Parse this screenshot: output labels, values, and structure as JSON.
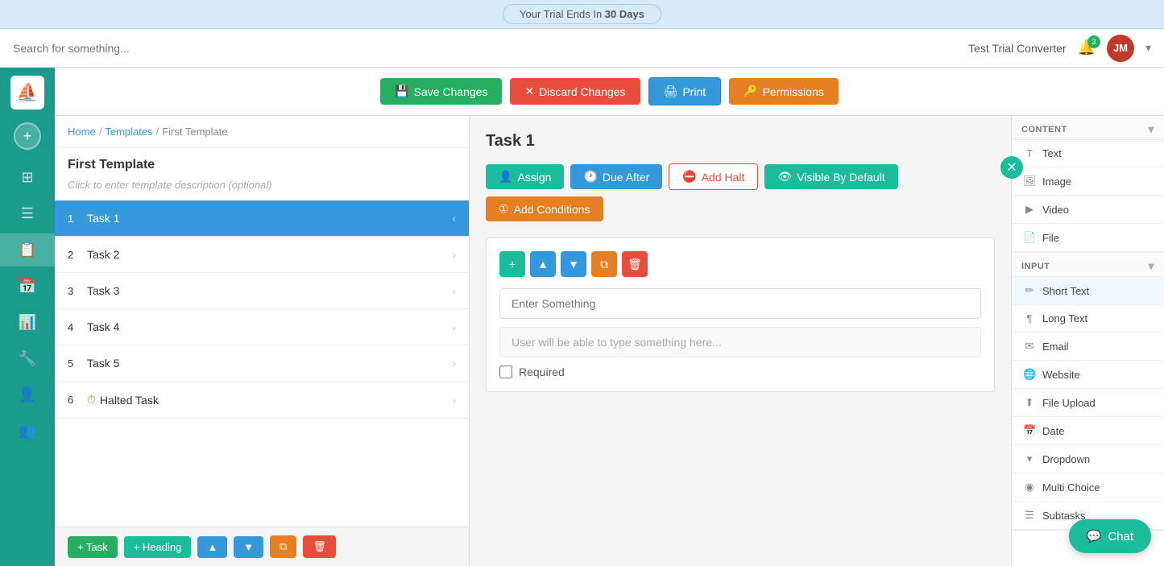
{
  "trial_bar": {
    "text": "Your Trial Ends In ",
    "bold": "30 Days"
  },
  "topbar": {
    "search_placeholder": "Search for something...",
    "workspace": "Test Trial Converter",
    "badge": "3",
    "avatar": "JM"
  },
  "toolbar": {
    "save_label": "Save Changes",
    "discard_label": "Discard Changes",
    "print_label": "Print",
    "permissions_label": "Permissions"
  },
  "sidebar": {
    "nav_items": [
      {
        "icon": "⊞",
        "name": "dashboard"
      },
      {
        "icon": "☰",
        "name": "tasks"
      },
      {
        "icon": "📅",
        "name": "calendar"
      },
      {
        "icon": "📋",
        "name": "templates"
      },
      {
        "icon": "📊",
        "name": "reports"
      },
      {
        "icon": "🔧",
        "name": "settings"
      },
      {
        "icon": "👤",
        "name": "profile"
      },
      {
        "icon": "👥",
        "name": "team"
      }
    ]
  },
  "breadcrumb": {
    "home": "Home",
    "templates": "Templates",
    "current": "First Template"
  },
  "left_panel": {
    "template_name": "First Template",
    "template_desc": "Click to enter template description (optional)",
    "tasks": [
      {
        "num": 1,
        "name": "Task 1",
        "active": true,
        "halted": false
      },
      {
        "num": 2,
        "name": "Task 2",
        "active": false,
        "halted": false
      },
      {
        "num": 3,
        "name": "Task 3",
        "active": false,
        "halted": false
      },
      {
        "num": 4,
        "name": "Task 4",
        "active": false,
        "halted": false
      },
      {
        "num": 5,
        "name": "Task 5",
        "active": false,
        "halted": false
      },
      {
        "num": 6,
        "name": "Halted Task",
        "active": false,
        "halted": true
      }
    ]
  },
  "bottom_actions": {
    "add_task": "+ Task",
    "add_heading": "+ Heading",
    "move_up": "▲",
    "move_down": "▼",
    "copy": "⧉",
    "delete": "🗑"
  },
  "task_section": {
    "title": "Task 1",
    "assign_label": "Assign",
    "due_after_label": "Due After",
    "add_halt_label": "Add Halt",
    "visible_by_default_label": "Visible By Default",
    "add_conditions_label": "Add Conditions",
    "content_label_placeholder": "Enter Something",
    "content_input_placeholder": "User will be able to type something here...",
    "required_label": "Required"
  },
  "right_panel": {
    "content_header": "CONTENT",
    "content_items": [
      {
        "icon": "T",
        "label": "Text"
      },
      {
        "icon": "🖼",
        "label": "Image"
      },
      {
        "icon": "▶",
        "label": "Video"
      },
      {
        "icon": "📄",
        "label": "File"
      }
    ],
    "input_header": "INPUT",
    "input_items": [
      {
        "icon": "✏",
        "label": "Short Text"
      },
      {
        "icon": "¶",
        "label": "Long Text"
      },
      {
        "icon": "✉",
        "label": "Email"
      },
      {
        "icon": "🌐",
        "label": "Website"
      },
      {
        "icon": "⬆",
        "label": "File Upload"
      },
      {
        "icon": "📅",
        "label": "Date"
      },
      {
        "icon": "▾",
        "label": "Dropdown"
      },
      {
        "icon": "◉",
        "label": "Multi Choice"
      },
      {
        "icon": "☰",
        "label": "Subtasks"
      }
    ]
  },
  "chat": {
    "label": "Chat"
  }
}
